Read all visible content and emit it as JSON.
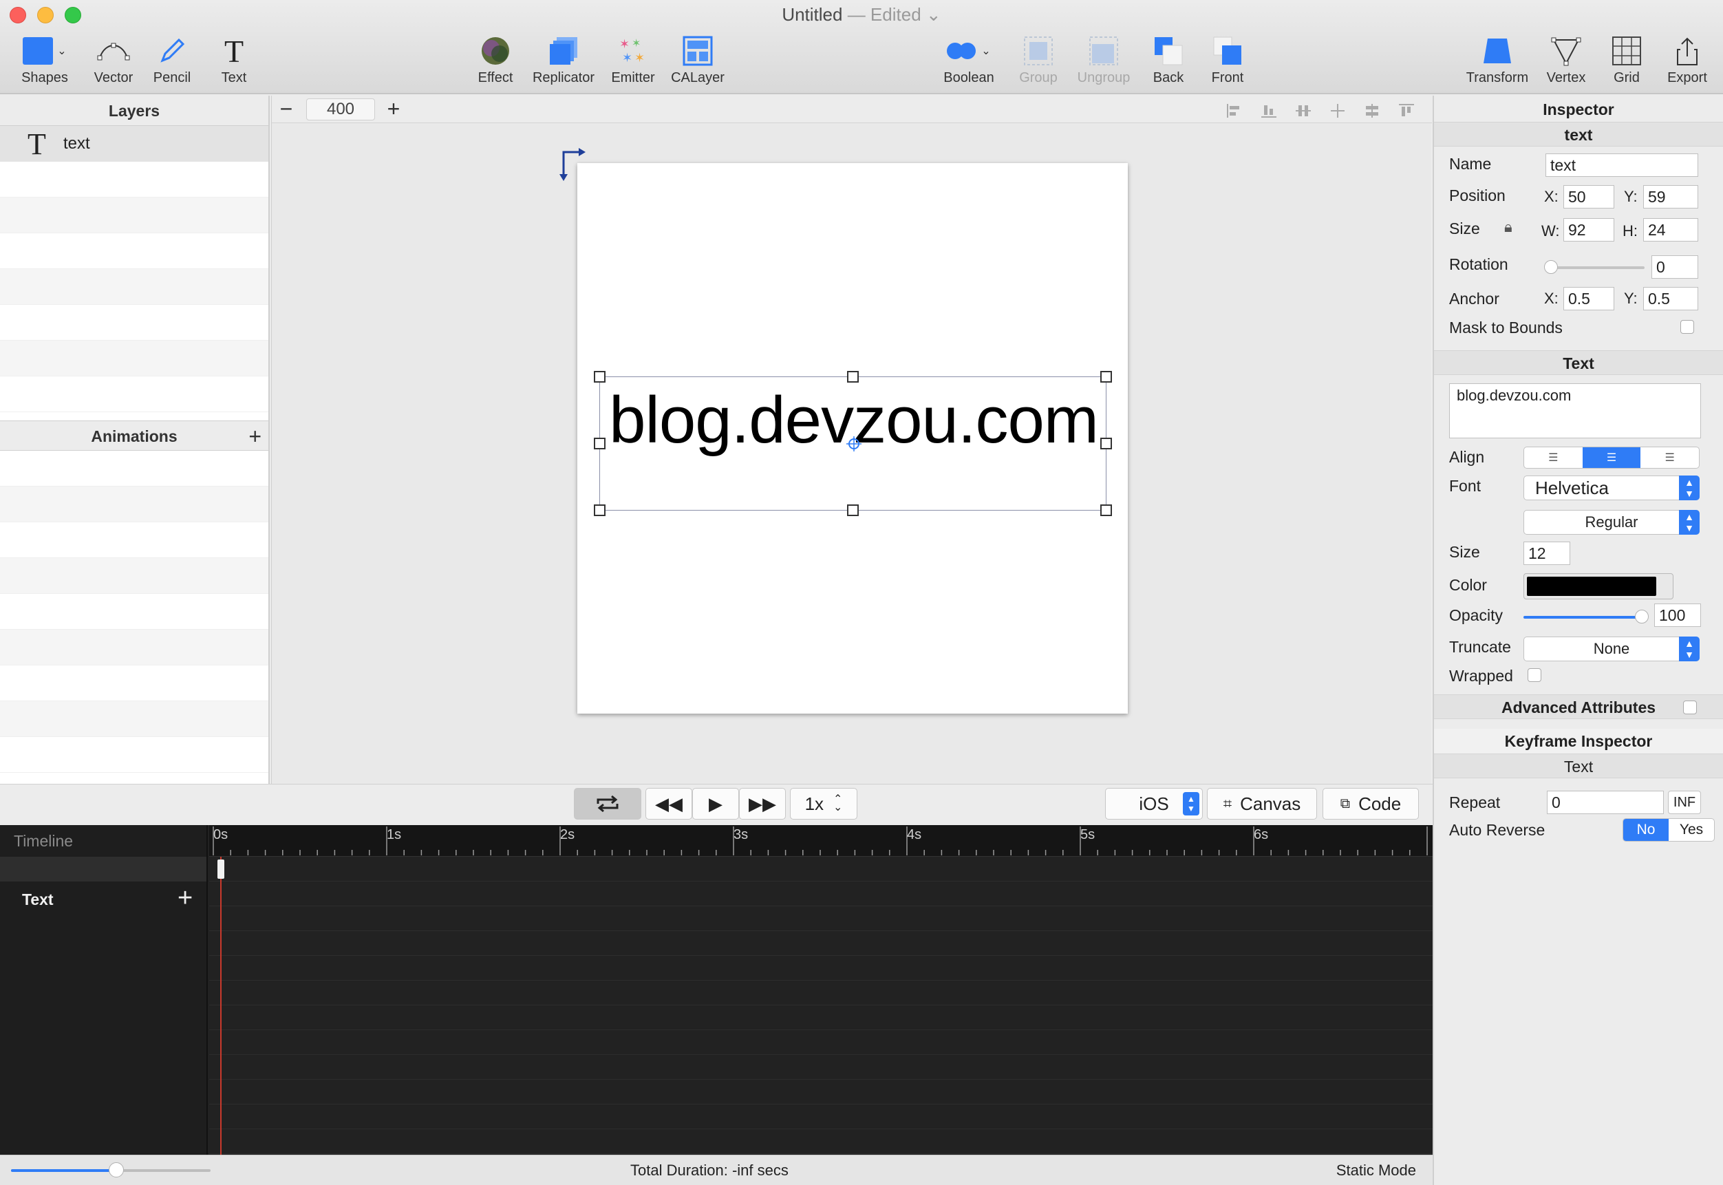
{
  "window": {
    "title": "Untitled",
    "status": "— Edited"
  },
  "toolbar": {
    "shapes": "Shapes",
    "vector": "Vector",
    "pencil": "Pencil",
    "text": "Text",
    "effect": "Effect",
    "replicator": "Replicator",
    "emitter": "Emitter",
    "calayer": "CALayer",
    "boolean": "Boolean",
    "group": "Group",
    "ungroup": "Ungroup",
    "back": "Back",
    "front": "Front",
    "transform": "Transform",
    "vertex": "Vertex",
    "grid": "Grid",
    "export": "Export"
  },
  "layers": {
    "title": "Layers",
    "items": [
      {
        "name": "text"
      }
    ]
  },
  "animations": {
    "title": "Animations"
  },
  "canvas": {
    "zoom": "400",
    "text": "blog.devzou.com"
  },
  "playback": {
    "speed": "1x",
    "platform": "iOS",
    "canvas_label": "Canvas",
    "code_label": "Code"
  },
  "timeline": {
    "header": "Timeline",
    "track": "Text",
    "ruler": [
      "0s",
      "1s",
      "2s",
      "3s",
      "4s",
      "5s",
      "6s"
    ]
  },
  "status": {
    "duration": "Total Duration: -inf secs",
    "mode": "Static Mode"
  },
  "inspector": {
    "title": "Inspector",
    "layer_name": "text",
    "name_label": "Name",
    "name_value": "text",
    "position_label": "Position",
    "pos_x": "50",
    "pos_y": "59",
    "size_label": "Size",
    "size_w": "92",
    "size_h": "24",
    "rotation_label": "Rotation",
    "rotation": "0",
    "anchor_label": "Anchor",
    "anchor_x": "0.5",
    "anchor_y": "0.5",
    "mask_label": "Mask to Bounds",
    "text_section": "Text",
    "text_value": "blog.devzou.com",
    "align_label": "Align",
    "font_label": "Font",
    "font": "Helvetica",
    "font_style": "Regular",
    "font_size_label": "Size",
    "font_size": "12",
    "color_label": "Color",
    "color": "#000000",
    "opacity_label": "Opacity",
    "opacity": "100",
    "truncate_label": "Truncate",
    "truncate": "None",
    "wrapped_label": "Wrapped",
    "advanced_label": "Advanced Attributes",
    "keyframe_title": "Keyframe Inspector",
    "keyframe_sub": "Text",
    "repeat_label": "Repeat",
    "repeat": "0",
    "inf_label": "INF",
    "autoreverse_label": "Auto Reverse",
    "no_label": "No",
    "yes_label": "Yes"
  },
  "colors": {
    "accent": "#2f7cf6",
    "playhead": "#c9392c"
  }
}
